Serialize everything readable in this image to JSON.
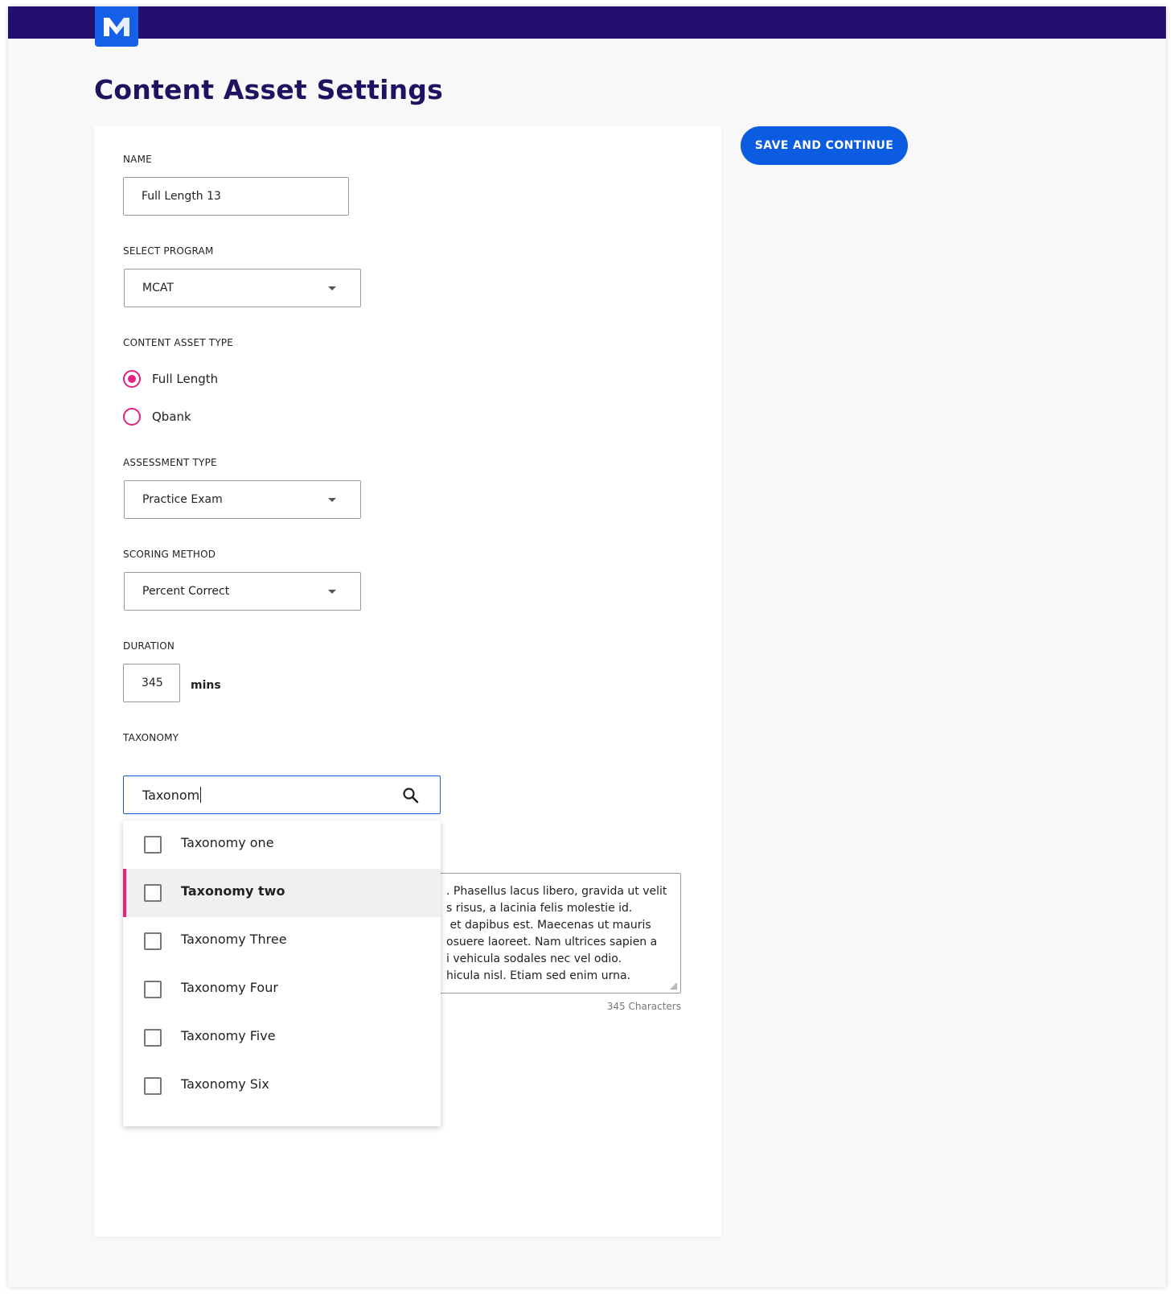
{
  "header": {
    "logo_letter": "M",
    "brand_color": "#220f6e",
    "logo_color": "#1560e6"
  },
  "page": {
    "title": "Content Asset Settings"
  },
  "actions": {
    "save_label": "SAVE AND CONTINUE",
    "accent_color": "#0b5ce0"
  },
  "form": {
    "name": {
      "label": "NAME",
      "value": "Full Length 13"
    },
    "program": {
      "label": "SELECT PROGRAM",
      "value": "MCAT"
    },
    "content_asset_type": {
      "label": "CONTENT ASSET TYPE",
      "options": [
        {
          "label": "Full Length",
          "checked": true
        },
        {
          "label": "Qbank",
          "checked": false
        }
      ]
    },
    "assessment_type": {
      "label": "ASSESSMENT TYPE",
      "value": "Practice Exam"
    },
    "scoring_method": {
      "label": "SCORING METHOD",
      "value": "Percent Correct"
    },
    "duration": {
      "label": "DURATION",
      "value": "345",
      "unit": "mins"
    },
    "taxonomy": {
      "label": "TAXONOMY",
      "query": "Taxonom",
      "search_icon": "search-icon",
      "options": [
        {
          "label": "Taxonomy one",
          "checked": false,
          "highlighted": false
        },
        {
          "label": "Taxonomy two",
          "checked": false,
          "highlighted": true
        },
        {
          "label": "Taxonomy Three",
          "checked": false,
          "highlighted": false
        },
        {
          "label": "Taxonomy Four",
          "checked": false,
          "highlighted": false
        },
        {
          "label": "Taxonomy Five",
          "checked": false,
          "highlighted": false
        },
        {
          "label": "Taxonomy Six",
          "checked": false,
          "highlighted": false
        }
      ]
    },
    "description": {
      "visible_text": ". Phasellus lacus libero, gravida ut velit\ns risus, a lacinia felis molestie id.\n et dapibus est. Maecenas ut mauris\nosuere laoreet. Nam ultrices sapien a\ni vehicula sodales nec vel odio.\nhicula nisl. Etiam sed enim urna.",
      "char_count": "345 Characters"
    },
    "highlight_color": "#e8207e"
  }
}
